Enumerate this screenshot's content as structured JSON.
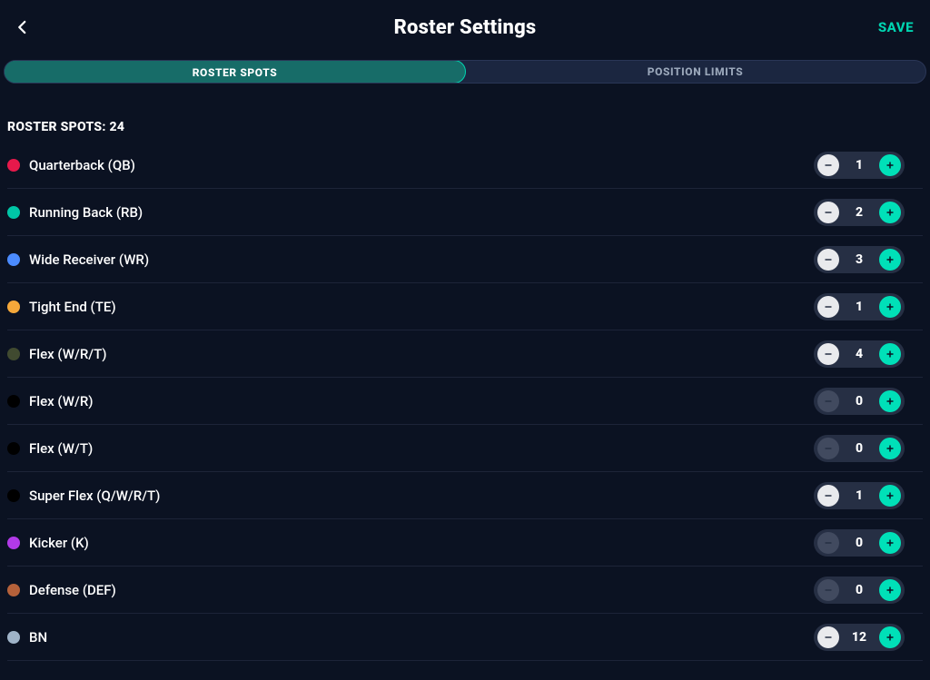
{
  "header": {
    "title": "Roster Settings",
    "save_label": "SAVE"
  },
  "tabs": {
    "roster_spots": "ROSTER SPOTS",
    "position_limits": "POSITION LIMITS"
  },
  "summary": {
    "label": "ROSTER SPOTS: 24"
  },
  "positions": [
    {
      "label": "Quarterback (QB)",
      "value": "1",
      "color": "#e6194b",
      "minus_enabled": true
    },
    {
      "label": "Running Back (RB)",
      "value": "2",
      "color": "#00c6a7",
      "minus_enabled": true
    },
    {
      "label": "Wide Receiver (WR)",
      "value": "3",
      "color": "#4b8bff",
      "minus_enabled": true
    },
    {
      "label": "Tight End (TE)",
      "value": "1",
      "color": "#f5a83a",
      "minus_enabled": true
    },
    {
      "label": "Flex (W/R/T)",
      "value": "4",
      "color": "#404a30",
      "minus_enabled": true
    },
    {
      "label": "Flex (W/R)",
      "value": "0",
      "color": "#000000",
      "minus_enabled": false
    },
    {
      "label": "Flex (W/T)",
      "value": "0",
      "color": "#000000",
      "minus_enabled": false
    },
    {
      "label": "Super Flex (Q/W/R/T)",
      "value": "1",
      "color": "#000000",
      "minus_enabled": true
    },
    {
      "label": "Kicker (K)",
      "value": "0",
      "color": "#b23ae8",
      "minus_enabled": false
    },
    {
      "label": "Defense (DEF)",
      "value": "0",
      "color": "#b5613a",
      "minus_enabled": false
    },
    {
      "label": "BN",
      "value": "12",
      "color": "#9fb3c8",
      "minus_enabled": true
    }
  ]
}
